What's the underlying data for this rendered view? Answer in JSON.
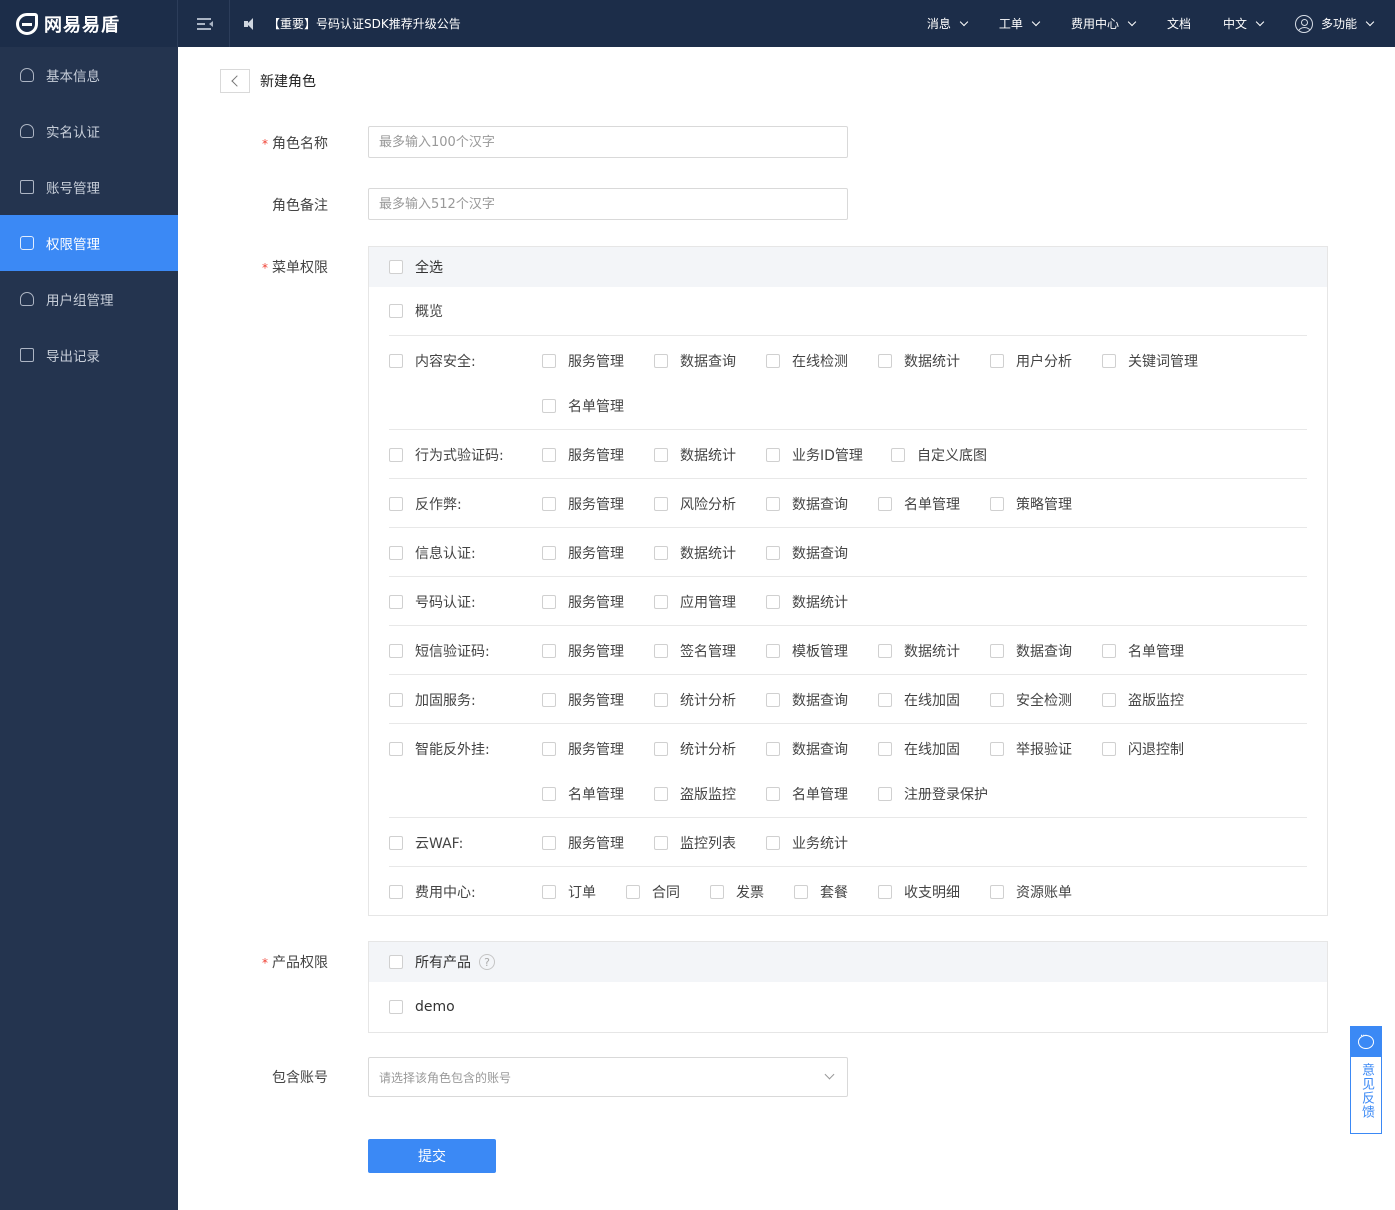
{
  "header": {
    "logo_text": "网易易盾",
    "notice": "【重要】号码认证SDK推荐升级公告",
    "nav": [
      {
        "label": "消息",
        "dropdown": true
      },
      {
        "label": "工单",
        "dropdown": true
      },
      {
        "label": "费用中心",
        "dropdown": true
      },
      {
        "label": "文档",
        "dropdown": false
      },
      {
        "label": "中文",
        "dropdown": true
      }
    ],
    "user": "多功能"
  },
  "sidebar": {
    "items": [
      {
        "label": "基本信息"
      },
      {
        "label": "实名认证"
      },
      {
        "label": "账号管理"
      },
      {
        "label": "权限管理",
        "active": true
      },
      {
        "label": "用户组管理"
      },
      {
        "label": "导出记录"
      }
    ]
  },
  "page": {
    "title": "新建角色",
    "role_name_label": "角色名称",
    "role_name_placeholder": "最多输入100个汉字",
    "role_note_label": "角色备注",
    "role_note_placeholder": "最多输入512个汉字",
    "menu_perm_label": "菜单权限",
    "select_all": "全选",
    "overview": "概览",
    "categories": [
      {
        "name": "内容安全:",
        "items": [
          "服务管理",
          "数据查询",
          "在线检测",
          "数据统计",
          "用户分析",
          "关键词管理",
          "名单管理"
        ]
      },
      {
        "name": "行为式验证码:",
        "items": [
          "服务管理",
          "数据统计",
          "业务ID管理",
          "自定义底图"
        ]
      },
      {
        "name": "反作弊:",
        "items": [
          "服务管理",
          "风险分析",
          "数据查询",
          "名单管理",
          "策略管理"
        ]
      },
      {
        "name": "信息认证:",
        "items": [
          "服务管理",
          "数据统计",
          "数据查询"
        ]
      },
      {
        "name": "号码认证:",
        "items": [
          "服务管理",
          "应用管理",
          "数据统计"
        ]
      },
      {
        "name": "短信验证码:",
        "items": [
          "服务管理",
          "签名管理",
          "模板管理",
          "数据统计",
          "数据查询",
          "名单管理"
        ]
      },
      {
        "name": "加固服务:",
        "items": [
          "服务管理",
          "统计分析",
          "数据查询",
          "在线加固",
          "安全检测",
          "盗版监控"
        ]
      },
      {
        "name": "智能反外挂:",
        "items": [
          "服务管理",
          "统计分析",
          "数据查询",
          "在线加固",
          "举报验证",
          "闪退控制",
          "名单管理",
          "盗版监控",
          "名单管理",
          "注册登录保护"
        ]
      },
      {
        "name": "云WAF:",
        "items": [
          "服务管理",
          "监控列表",
          "业务统计"
        ]
      },
      {
        "name": "费用中心:",
        "items": [
          "订单",
          "合同",
          "发票",
          "套餐",
          "收支明细",
          "资源账单"
        ]
      }
    ],
    "product_perm_label": "产品权限",
    "all_products": "所有产品",
    "help_mark": "?",
    "products": [
      "demo"
    ],
    "accounts_label": "包含账号",
    "accounts_placeholder": "请选择该角色包含的账号",
    "submit": "提交",
    "feedback": "意见反馈"
  },
  "colors": {
    "primary": "#3b89f5",
    "sidebar": "#24344f",
    "topbar": "#1c2d49",
    "required": "#f04134"
  }
}
